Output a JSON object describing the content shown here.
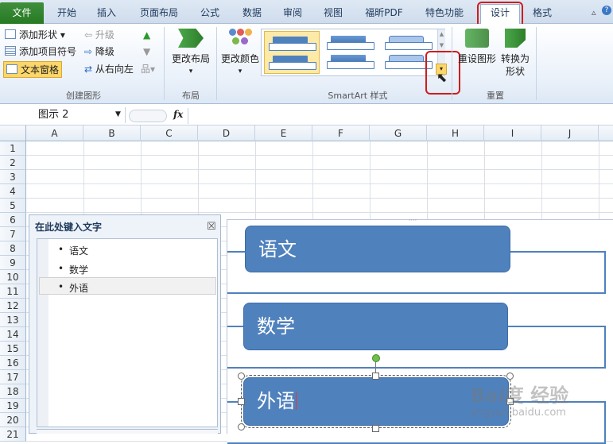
{
  "tabs": {
    "file": "文件",
    "home": "开始",
    "insert": "插入",
    "page_layout": "页面布局",
    "formulas": "公式",
    "data": "数据",
    "review": "审阅",
    "view": "视图",
    "foxit_pdf": "福昕PDF",
    "features": "特色功能",
    "design": "设计",
    "format": "格式"
  },
  "ribbon": {
    "create_graphic": {
      "add_shape": "添加形状",
      "add_bullet": "添加项目符号",
      "text_pane": "文本窗格",
      "promote": "升级",
      "demote": "降级",
      "right_to_left": "从右向左",
      "label": "创建图形"
    },
    "layouts": {
      "change_layout": "更改布局",
      "label": "布局"
    },
    "styles": {
      "change_colors": "更改颜色",
      "label": "SmartArt 样式"
    },
    "reset": {
      "reset_graphic": "重设图形",
      "convert_line1": "转换为",
      "convert_line2": "形状",
      "label": "重置"
    }
  },
  "formula_bar": {
    "name_box": "图示 2",
    "fx": "fx"
  },
  "columns": [
    "A",
    "B",
    "C",
    "D",
    "E",
    "F",
    "G",
    "H",
    "I",
    "J"
  ],
  "rows": [
    "1",
    "2",
    "3",
    "4",
    "5",
    "6",
    "7",
    "8",
    "9",
    "10",
    "11",
    "12",
    "13",
    "14",
    "15",
    "16",
    "17",
    "18",
    "19",
    "20",
    "21"
  ],
  "text_pane": {
    "title": "在此处键入文字",
    "close": "☒",
    "items": [
      "语文",
      "数学",
      "外语"
    ]
  },
  "smartart": {
    "boxes": [
      "语文",
      "数学",
      "外语"
    ]
  },
  "watermark": {
    "brand": "Bai度 经验",
    "url": "jingyan.baidu.com"
  },
  "colors": {
    "accent": "#4f81bd",
    "file_tab": "#2e7d2a",
    "highlight": "#d01c1c"
  }
}
